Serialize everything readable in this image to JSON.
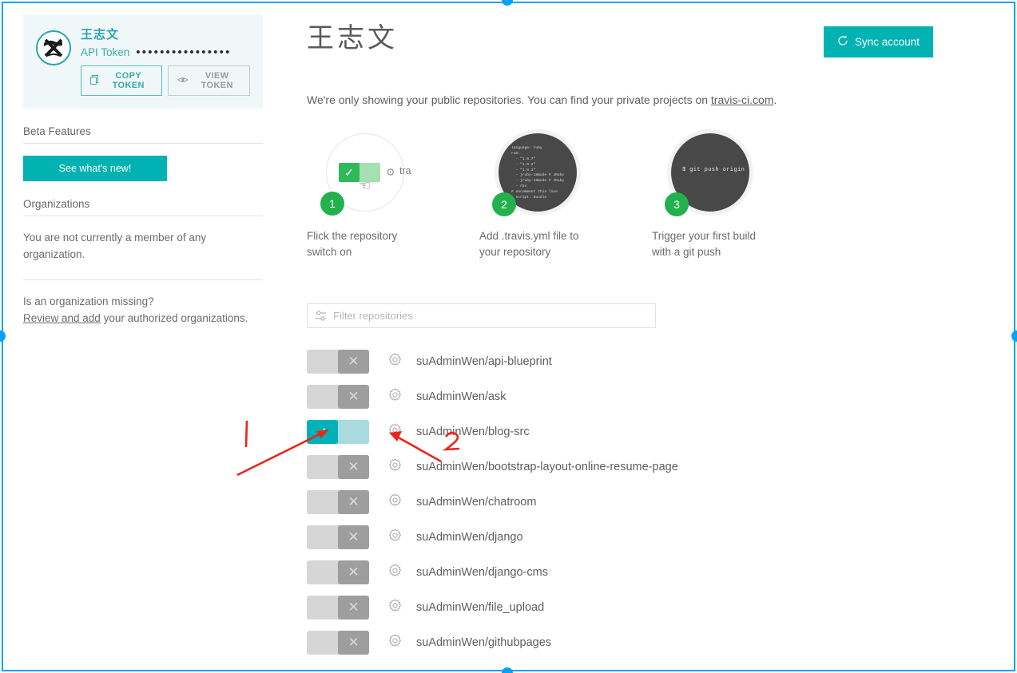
{
  "profile": {
    "name": "王志文",
    "avatar_icon": "user-avatar-icon",
    "token_label": "API Token",
    "token_masked": "••••••••••••••••",
    "copy_token_label": "COPY TOKEN",
    "copy_icon": "copy-icon",
    "view_token_label": "VIEW TOKEN",
    "view_icon": "eye-icon"
  },
  "sidebar": {
    "beta_heading": "Beta Features",
    "beta_button_label": "See what's new!",
    "organizations_heading": "Organizations",
    "organizations_empty": "You are not currently a member of any organization.",
    "missing_question": "Is an organization missing?",
    "review_link_label": "Review and add",
    "missing_tail": " your authorized organizations."
  },
  "header": {
    "title": "王志文",
    "sync_button_label": "Sync account",
    "sync_icon": "refresh-icon",
    "intro_prefix": "We're only showing your public repositories. You can find your private projects on ",
    "intro_link": "travis-ci.com",
    "intro_suffix": "."
  },
  "steps": [
    {
      "number": "1",
      "caption": "Flick the repository switch on",
      "icon": "toggle-switch-illustration",
      "gear_icon": "gear-icon",
      "repo_hint": "tra",
      "cursor_icon": "pointer-hand-icon"
    },
    {
      "number": "2",
      "caption": "Add .travis.yml file to your repository",
      "icon": "yaml-code-illustration",
      "code": "language: ruby\nrvm:\n  - \"1.8.7\"\n  - \"1.9.2\"\n  - \"1.9.3\"\n  - jruby-18mode # JRuby\n  - jruby-19mode # JRuby\n  - rbx\n# uncomment this line\n  script: bundle"
    },
    {
      "number": "3",
      "caption": "Trigger your first build with a git push",
      "icon": "terminal-illustration",
      "code": "$ git push origin"
    }
  ],
  "filter": {
    "placeholder": "Filter repositories",
    "value": "",
    "icon": "filter-sliders-icon"
  },
  "repositories": [
    {
      "name": "suAdminWen/api-blueprint",
      "enabled": false,
      "gear_icon": "gear-icon"
    },
    {
      "name": "suAdminWen/ask",
      "enabled": false,
      "gear_icon": "gear-icon"
    },
    {
      "name": "suAdminWen/blog-src",
      "enabled": true,
      "gear_icon": "gear-icon"
    },
    {
      "name": "suAdminWen/bootstrap-layout-online-resume-page",
      "enabled": false,
      "gear_icon": "gear-icon"
    },
    {
      "name": "suAdminWen/chatroom",
      "enabled": false,
      "gear_icon": "gear-icon"
    },
    {
      "name": "suAdminWen/django",
      "enabled": false,
      "gear_icon": "gear-icon"
    },
    {
      "name": "suAdminWen/django-cms",
      "enabled": false,
      "gear_icon": "gear-icon"
    },
    {
      "name": "suAdminWen/file_upload",
      "enabled": false,
      "gear_icon": "gear-icon"
    },
    {
      "name": "suAdminWen/githubpages",
      "enabled": false,
      "gear_icon": "gear-icon"
    }
  ],
  "toggle_glyphs": {
    "on": "✓",
    "off": "✕"
  },
  "annotations": [
    {
      "label": "1",
      "target": "repository-toggle-blog-src"
    },
    {
      "label": "2",
      "target": "repository-settings-gear-blog-src"
    }
  ],
  "colors": {
    "accent_teal": "#00b2b2",
    "toggle_on": "#00b2b8",
    "toggle_on_track": "#a8dade",
    "toggle_off": "#9e9e9e",
    "badge_green": "#22b14c",
    "annotation_red": "#e8261c",
    "selection_blue": "#00a3f5"
  }
}
